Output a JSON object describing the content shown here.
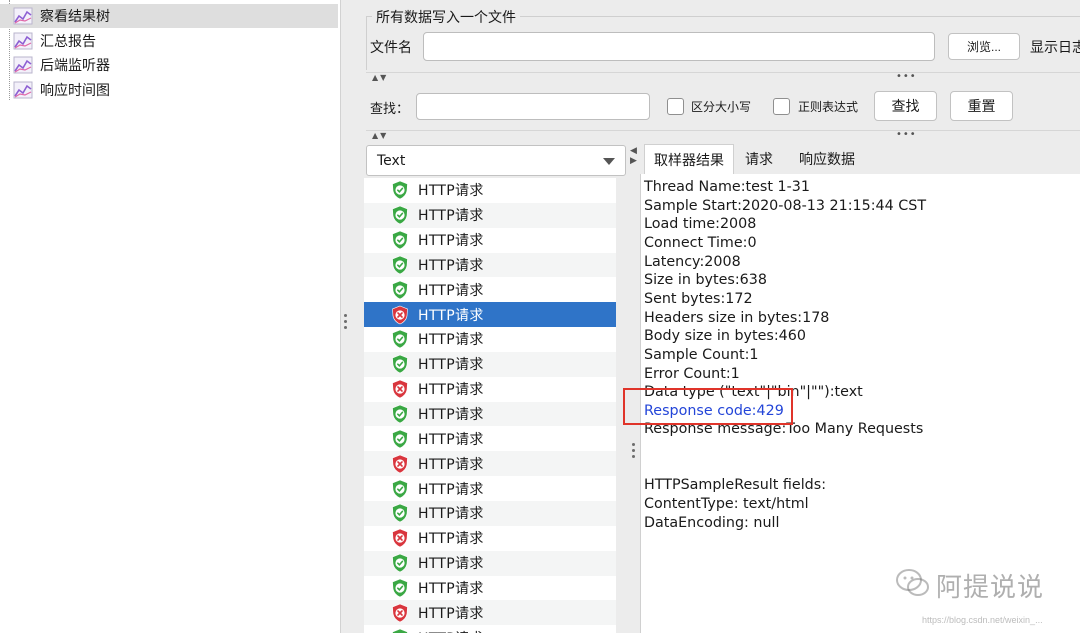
{
  "tree": {
    "items": [
      {
        "label": "察看结果树",
        "selected": true
      },
      {
        "label": "汇总报告",
        "selected": false
      },
      {
        "label": "后端监听器",
        "selected": false
      },
      {
        "label": "响应时间图",
        "selected": false
      }
    ],
    "icon": "graph-icon"
  },
  "file_section": {
    "legend": "所有数据写入一个文件",
    "filename_label": "文件名",
    "filename_value": "",
    "browse_label": "浏览...",
    "log_label": "显示日志"
  },
  "search": {
    "label": "查找：",
    "value": "",
    "case_sensitive_label": "区分大小写",
    "case_sensitive_checked": false,
    "regex_label": "正则表达式",
    "regex_checked": false,
    "find_button": "查找",
    "reset_button": "重置"
  },
  "renderer_select": {
    "selected": "Text"
  },
  "samples": [
    {
      "name": "HTTP请求",
      "status": "success"
    },
    {
      "name": "HTTP请求",
      "status": "success"
    },
    {
      "name": "HTTP请求",
      "status": "success"
    },
    {
      "name": "HTTP请求",
      "status": "success"
    },
    {
      "name": "HTTP请求",
      "status": "success"
    },
    {
      "name": "HTTP请求",
      "status": "error",
      "selected": true
    },
    {
      "name": "HTTP请求",
      "status": "success"
    },
    {
      "name": "HTTP请求",
      "status": "success"
    },
    {
      "name": "HTTP请求",
      "status": "error"
    },
    {
      "name": "HTTP请求",
      "status": "success"
    },
    {
      "name": "HTTP请求",
      "status": "success"
    },
    {
      "name": "HTTP请求",
      "status": "error"
    },
    {
      "name": "HTTP请求",
      "status": "success"
    },
    {
      "name": "HTTP请求",
      "status": "success"
    },
    {
      "name": "HTTP请求",
      "status": "error"
    },
    {
      "name": "HTTP请求",
      "status": "success"
    },
    {
      "name": "HTTP请求",
      "status": "success"
    },
    {
      "name": "HTTP请求",
      "status": "error"
    },
    {
      "name": "HTTP请求",
      "status": "success"
    }
  ],
  "tabs": [
    {
      "label": "取样器结果",
      "active": true
    },
    {
      "label": "请求",
      "active": false
    },
    {
      "label": "响应数据",
      "active": false
    }
  ],
  "result_lines": [
    {
      "text": "Thread Name:test 1-31"
    },
    {
      "text": "Sample Start:2020-08-13 21:15:44 CST"
    },
    {
      "text": "Load time:2008"
    },
    {
      "text": "Connect Time:0"
    },
    {
      "text": "Latency:2008"
    },
    {
      "text": "Size in bytes:638"
    },
    {
      "text": "Sent bytes:172"
    },
    {
      "text": "Headers size in bytes:178"
    },
    {
      "text": "Body size in bytes:460"
    },
    {
      "text": "Sample Count:1"
    },
    {
      "text": "Error Count:1"
    },
    {
      "text": "Data type (\"text\"|\"bin\"|\"\"):text"
    },
    {
      "text": "Response code:429",
      "highlight": true
    },
    {
      "text": "Response message:Too Many Requests"
    },
    {
      "text": ""
    },
    {
      "text": ""
    },
    {
      "text": "HTTPSampleResult fields:"
    },
    {
      "text": "ContentType: text/html"
    },
    {
      "text": "DataEncoding: null"
    }
  ],
  "watermark": {
    "text": "阿提说说",
    "url": "https://blog.csdn.net/weixin_..."
  },
  "colors": {
    "selection": "#2f74c8",
    "success_shield": "#3aa844",
    "error_shield": "#d9363e",
    "highlight_text": "#2345d8",
    "annotation_box": "#e0342a"
  }
}
